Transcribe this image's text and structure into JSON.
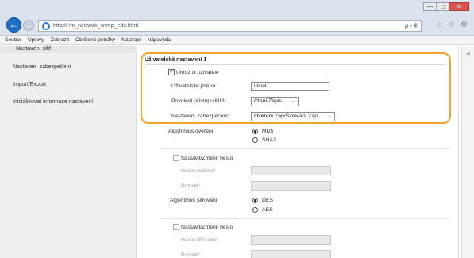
{
  "window": {
    "minimize": "—",
    "maximize": "□",
    "close": "✕"
  },
  "address_bar": {
    "url": "http://                    /m_network_snmp_edit.html",
    "tools": "ρ - ¢"
  },
  "menubar": [
    "Soubor",
    "Úpravy",
    "Zobrazit",
    "Oblíbené položky",
    "Nástroje",
    "Nápověda"
  ],
  "sidebar": {
    "items": [
      "Nastavení sítě",
      "Nastavení zabezpečení",
      "Import/Export",
      "Inicializovat informace nastavení"
    ]
  },
  "user_settings": {
    "title": "Uživatelská nastavení 1",
    "enable_user_label": "Umožnit uživatele",
    "enable_user_checked": "✓",
    "username_label": "Uživatelské jméno:",
    "username_value": "initial",
    "access_label": "Povolení přístupu MIB:",
    "access_value": "Čtení/Zápis",
    "security_label": "Nastavení zabezpečení:",
    "security_value": "Ověření Zap/Šifrování Zap"
  },
  "auth": {
    "algorithm_label": "Algoritmus ověření:",
    "options": [
      "MD5",
      "SHA1"
    ],
    "selected": "MD5",
    "set_change_label": "Nastavit/Změnit heslo",
    "password_label": "Heslo ověření:",
    "confirm_label": "Potvrdit:"
  },
  "encryption": {
    "algorithm_label": "Algoritmus šifrování:",
    "options": [
      "DES",
      "AES"
    ],
    "selected": "DES",
    "set_change_label": "Nastavit/Změnit heslo",
    "password_label": "Heslo šifrování:",
    "confirm_label": "Potvrdit:"
  },
  "colors": {
    "highlight": "#f3a32a",
    "back_button": "#1e6fc8"
  }
}
